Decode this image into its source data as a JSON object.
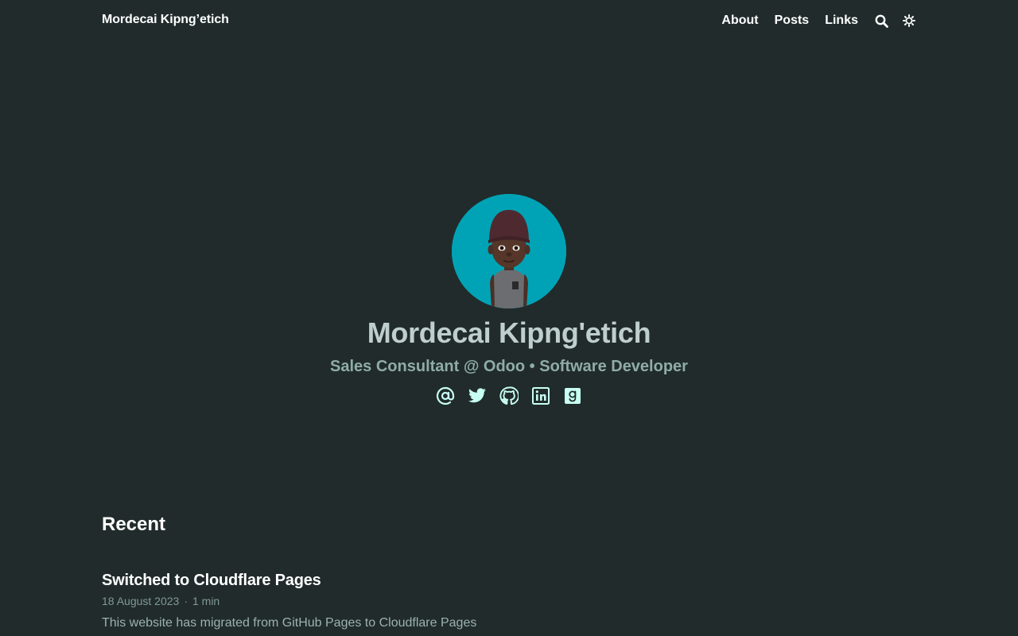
{
  "header": {
    "brand": "Mordecai Kipng’etich",
    "nav": [
      {
        "label": "About"
      },
      {
        "label": "Posts"
      },
      {
        "label": "Links"
      }
    ],
    "search_icon": "search-icon",
    "theme_icon": "sun-icon"
  },
  "hero": {
    "avatar_alt": "avatar",
    "name": "Mordecai Kipng'etich",
    "subtitle": "Sales Consultant @ Odoo • Software Developer",
    "socials": [
      "at-sign-icon",
      "twitter-icon",
      "github-icon",
      "linkedin-icon",
      "goodreads-icon"
    ]
  },
  "recent": {
    "heading": "Recent",
    "posts": [
      {
        "title": "Switched to Cloudflare Pages",
        "date": "18 August 2023",
        "read_time": "1 min",
        "summary": "This website has migrated from GitHub Pages to Cloudflare Pages"
      }
    ]
  },
  "colors": {
    "background": "#212b2b",
    "accent": "#c8fff4",
    "avatar_bg": "#00a3b5"
  }
}
